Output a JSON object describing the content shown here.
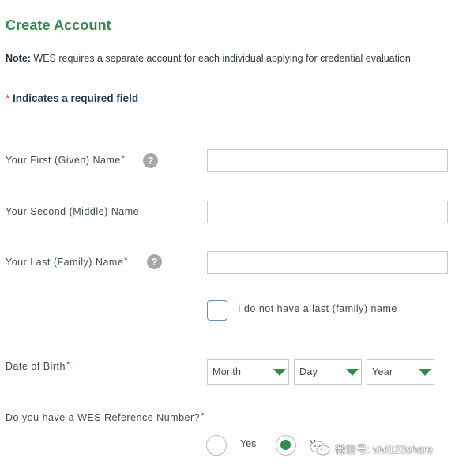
{
  "header": {
    "title": "Create Account"
  },
  "note": {
    "label": "Note:",
    "text": " WES requires a separate account for each individual applying for credential evaluation."
  },
  "required_note": {
    "asterisk": "*",
    "text": " Indicates a required field"
  },
  "form": {
    "first_name": {
      "label": "Your First (Given) Name",
      "required_mark": "*",
      "help_icon": "?",
      "value": ""
    },
    "middle_name": {
      "label": "Your Second (Middle) Name",
      "value": ""
    },
    "last_name": {
      "label": "Your Last (Family) Name",
      "required_mark": "*",
      "help_icon": "?",
      "value": ""
    },
    "no_last_name": {
      "label": "I do not have a last (family) name",
      "checked": false
    },
    "dob": {
      "label": "Date of Birth",
      "required_mark": "*",
      "month": "Month",
      "day": "Day",
      "year": "Year"
    },
    "wes_reference": {
      "label": "Do you have a WES Reference Number?",
      "required_mark": "*",
      "yes_label": "Yes",
      "no_label": "No",
      "selected": "No"
    }
  },
  "watermark": {
    "text": "微信号: vivi123share",
    "icon": "wechat-icon"
  },
  "colors": {
    "brand_green": "#2e8b4b",
    "required_red": "#c8322a"
  }
}
